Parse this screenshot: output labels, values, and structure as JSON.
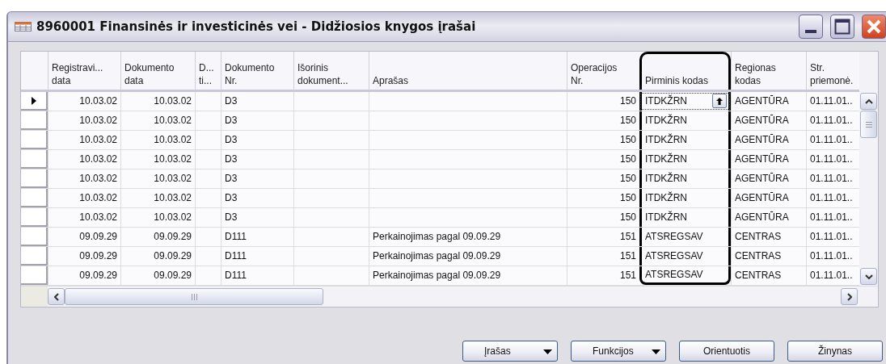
{
  "window": {
    "title": "8960001 Finansinės ir investicinės vei - Didžiosios knygos įrašai"
  },
  "table": {
    "columns": [
      {
        "lines": [
          "Registravi...",
          "data"
        ],
        "kind": "numeric",
        "focused": false,
        "highlighted": false
      },
      {
        "lines": [
          "Dokumento",
          "data"
        ],
        "kind": "numeric",
        "focused": false,
        "highlighted": false
      },
      {
        "lines": [
          "D...",
          "ti..."
        ],
        "kind": "text",
        "focused": false,
        "highlighted": false
      },
      {
        "lines": [
          "Dokumento",
          "Nr."
        ],
        "kind": "text",
        "focused": false,
        "highlighted": false
      },
      {
        "lines": [
          "Išorinis",
          "dokument..."
        ],
        "kind": "text",
        "focused": false,
        "highlighted": false
      },
      {
        "lines": [
          "Aprašas"
        ],
        "kind": "text",
        "focused": false,
        "highlighted": false
      },
      {
        "lines": [
          "Operacijos",
          "Nr."
        ],
        "kind": "numeric",
        "focused": false,
        "highlighted": false
      },
      {
        "lines": [
          "Pirminis kodas"
        ],
        "kind": "text",
        "focused": true,
        "highlighted": true
      },
      {
        "lines": [
          "Regionas",
          "kodas"
        ],
        "kind": "text",
        "focused": false,
        "highlighted": false
      },
      {
        "lines": [
          "Str.",
          "priemonė."
        ],
        "kind": "text",
        "focused": false,
        "highlighted": false
      }
    ],
    "rows": [
      {
        "selected": true,
        "cells": [
          "10.03.02",
          "10.03.02",
          "",
          "D3",
          "",
          "",
          "150",
          "ITDKŽRN",
          "AGENTŪRA",
          "01.11.01.."
        ]
      },
      {
        "selected": false,
        "cells": [
          "10.03.02",
          "10.03.02",
          "",
          "D3",
          "",
          "",
          "150",
          "ITDKŽRN",
          "AGENTŪRA",
          "01.11.01.."
        ]
      },
      {
        "selected": false,
        "cells": [
          "10.03.02",
          "10.03.02",
          "",
          "D3",
          "",
          "",
          "150",
          "ITDKŽRN",
          "AGENTŪRA",
          "01.11.01.."
        ]
      },
      {
        "selected": false,
        "cells": [
          "10.03.02",
          "10.03.02",
          "",
          "D3",
          "",
          "",
          "150",
          "ITDKŽRN",
          "AGENTŪRA",
          "01.11.01.."
        ]
      },
      {
        "selected": false,
        "cells": [
          "10.03.02",
          "10.03.02",
          "",
          "D3",
          "",
          "",
          "150",
          "ITDKŽRN",
          "AGENTŪRA",
          "01.11.01.."
        ]
      },
      {
        "selected": false,
        "cells": [
          "10.03.02",
          "10.03.02",
          "",
          "D3",
          "",
          "",
          "150",
          "ITDKŽRN",
          "AGENTŪRA",
          "01.11.01.."
        ]
      },
      {
        "selected": false,
        "cells": [
          "10.03.02",
          "10.03.02",
          "",
          "D3",
          "",
          "",
          "150",
          "ITDKŽRN",
          "AGENTŪRA",
          "01.11.01.."
        ]
      },
      {
        "selected": false,
        "cells": [
          "09.09.29",
          "09.09.29",
          "",
          "D111",
          "",
          "Perkainojimas  pagal 09.09.29",
          "151",
          "ATSREGSAV",
          "CENTRAS",
          "01.11.01.."
        ]
      },
      {
        "selected": false,
        "cells": [
          "09.09.29",
          "09.09.29",
          "",
          "D111",
          "",
          "Perkainojimas  pagal 09.09.29",
          "151",
          "ATSREGSAV",
          "CENTRAS",
          "01.11.01.."
        ]
      },
      {
        "selected": false,
        "cells": [
          "09.09.29",
          "09.09.29",
          "",
          "D111",
          "",
          "Perkainojimas  pagal 09.09.29",
          "151",
          "ATSREGSAV",
          "CENTRAS",
          "01.11.01.."
        ]
      }
    ]
  },
  "buttons": [
    {
      "label": "Įrašas",
      "kind": "dropdown"
    },
    {
      "label": "Funkcijos",
      "kind": "dropdown"
    },
    {
      "label": "Orientuotis",
      "kind": "plain"
    },
    {
      "label": "Žinynas",
      "kind": "plain"
    }
  ]
}
